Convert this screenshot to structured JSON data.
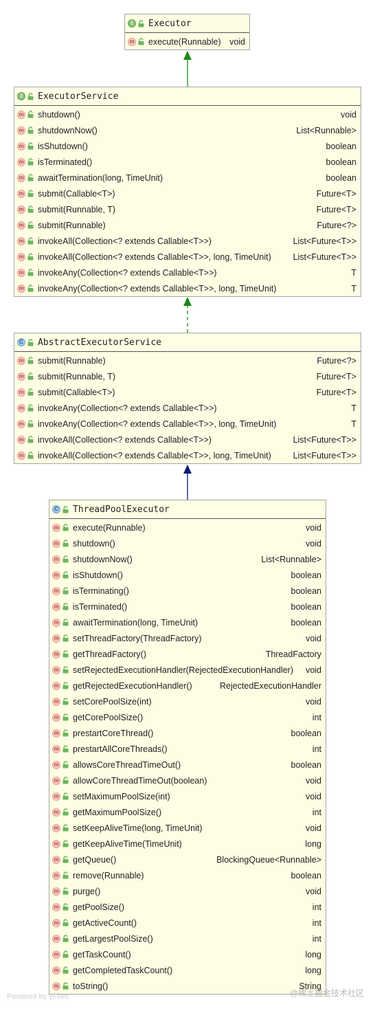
{
  "colors": {
    "realization_edge": "#1a8a1a",
    "inheritance_edge": "#0b1a7a",
    "class_fill": "#fefee4"
  },
  "classes": [
    {
      "key": "executor",
      "name": "Executor",
      "kind": "interface",
      "kind_badge": "I",
      "methods": [
        {
          "sig": "execute(Runnable)",
          "ret": "void"
        }
      ]
    },
    {
      "key": "executor_service",
      "name": "ExecutorService",
      "kind": "interface",
      "kind_badge": "I",
      "methods": [
        {
          "sig": "shutdown()",
          "ret": "void"
        },
        {
          "sig": "shutdownNow()",
          "ret": "List<Runnable>"
        },
        {
          "sig": "isShutdown()",
          "ret": "boolean"
        },
        {
          "sig": "isTerminated()",
          "ret": "boolean"
        },
        {
          "sig": "awaitTermination(long, TimeUnit)",
          "ret": "boolean"
        },
        {
          "sig": "submit(Callable<T>)",
          "ret": "Future<T>"
        },
        {
          "sig": "submit(Runnable, T)",
          "ret": "Future<T>"
        },
        {
          "sig": "submit(Runnable)",
          "ret": "Future<?>"
        },
        {
          "sig": "invokeAll(Collection<? extends Callable<T>>)",
          "ret": "List<Future<T>>"
        },
        {
          "sig": "invokeAll(Collection<? extends Callable<T>>, long, TimeUnit)",
          "ret": "List<Future<T>>"
        },
        {
          "sig": "invokeAny(Collection<? extends Callable<T>>)",
          "ret": "T"
        },
        {
          "sig": "invokeAny(Collection<? extends Callable<T>>, long, TimeUnit)",
          "ret": "T"
        }
      ]
    },
    {
      "key": "abstract_executor_service",
      "name": "AbstractExecutorService",
      "kind": "class",
      "kind_badge": "C",
      "methods": [
        {
          "sig": "submit(Runnable)",
          "ret": "Future<?>"
        },
        {
          "sig": "submit(Runnable, T)",
          "ret": "Future<T>"
        },
        {
          "sig": "submit(Callable<T>)",
          "ret": "Future<T>"
        },
        {
          "sig": "invokeAny(Collection<? extends Callable<T>>)",
          "ret": "T"
        },
        {
          "sig": "invokeAny(Collection<? extends Callable<T>>, long, TimeUnit)",
          "ret": "T"
        },
        {
          "sig": "invokeAll(Collection<? extends Callable<T>>)",
          "ret": "List<Future<T>>"
        },
        {
          "sig": "invokeAll(Collection<? extends Callable<T>>, long, TimeUnit)",
          "ret": "List<Future<T>>"
        }
      ]
    },
    {
      "key": "thread_pool_executor",
      "name": "ThreadPoolExecutor",
      "kind": "class",
      "kind_badge": "C",
      "methods": [
        {
          "sig": "execute(Runnable)",
          "ret": "void"
        },
        {
          "sig": "shutdown()",
          "ret": "void"
        },
        {
          "sig": "shutdownNow()",
          "ret": "List<Runnable>"
        },
        {
          "sig": "isShutdown()",
          "ret": "boolean"
        },
        {
          "sig": "isTerminating()",
          "ret": "boolean"
        },
        {
          "sig": "isTerminated()",
          "ret": "boolean"
        },
        {
          "sig": "awaitTermination(long, TimeUnit)",
          "ret": "boolean"
        },
        {
          "sig": "setThreadFactory(ThreadFactory)",
          "ret": "void"
        },
        {
          "sig": "getThreadFactory()",
          "ret": "ThreadFactory"
        },
        {
          "sig": "setRejectedExecutionHandler(RejectedExecutionHandler)",
          "ret": "void"
        },
        {
          "sig": "getRejectedExecutionHandler()",
          "ret": "RejectedExecutionHandler"
        },
        {
          "sig": "setCorePoolSize(int)",
          "ret": "void"
        },
        {
          "sig": "getCorePoolSize()",
          "ret": "int"
        },
        {
          "sig": "prestartCoreThread()",
          "ret": "boolean"
        },
        {
          "sig": "prestartAllCoreThreads()",
          "ret": "int"
        },
        {
          "sig": "allowsCoreThreadTimeOut()",
          "ret": "boolean"
        },
        {
          "sig": "allowCoreThreadTimeOut(boolean)",
          "ret": "void"
        },
        {
          "sig": "setMaximumPoolSize(int)",
          "ret": "void"
        },
        {
          "sig": "getMaximumPoolSize()",
          "ret": "int"
        },
        {
          "sig": "setKeepAliveTime(long, TimeUnit)",
          "ret": "void"
        },
        {
          "sig": "getKeepAliveTime(TimeUnit)",
          "ret": "long"
        },
        {
          "sig": "getQueue()",
          "ret": "BlockingQueue<Runnable>"
        },
        {
          "sig": "remove(Runnable)",
          "ret": "boolean"
        },
        {
          "sig": "purge()",
          "ret": "void"
        },
        {
          "sig": "getPoolSize()",
          "ret": "int"
        },
        {
          "sig": "getActiveCount()",
          "ret": "int"
        },
        {
          "sig": "getLargestPoolSize()",
          "ret": "int"
        },
        {
          "sig": "getTaskCount()",
          "ret": "long"
        },
        {
          "sig": "getCompletedTaskCount()",
          "ret": "long"
        },
        {
          "sig": "toString()",
          "ret": "String"
        }
      ]
    }
  ],
  "edges": [
    {
      "from": "executor_service",
      "to": "executor",
      "type": "generalization",
      "style": "solid"
    },
    {
      "from": "abstract_executor_service",
      "to": "executor_service",
      "type": "realization",
      "style": "dashed"
    },
    {
      "from": "thread_pool_executor",
      "to": "abstract_executor_service",
      "type": "generalization",
      "style": "solid"
    }
  ],
  "footer": {
    "powered_by": "Powered by yFiles",
    "watermark": "@稀土掘金技术社区"
  }
}
